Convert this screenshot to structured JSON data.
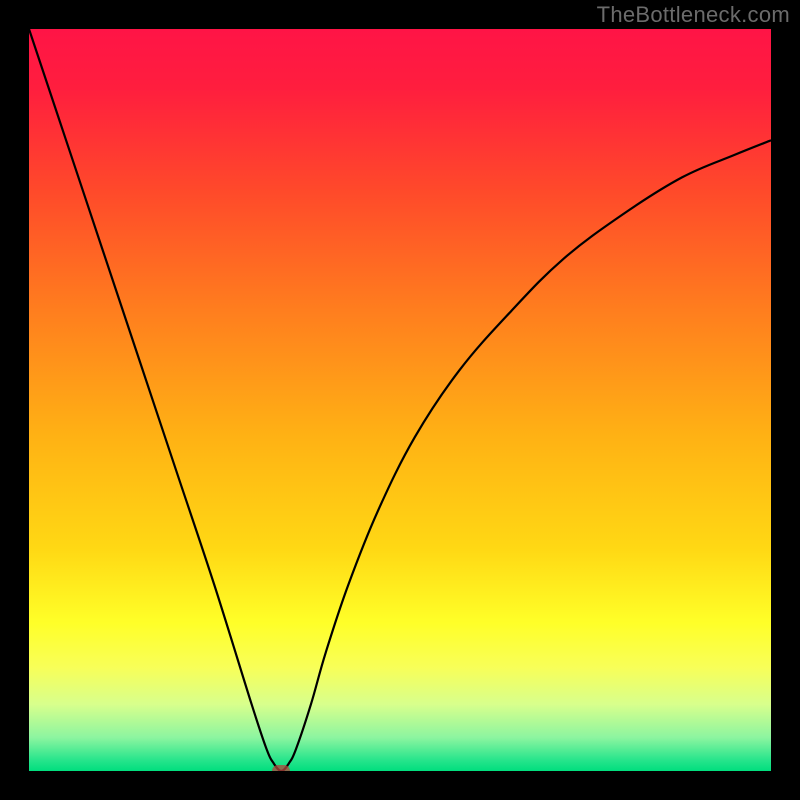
{
  "watermark": "TheBottleneck.com",
  "chart_data": {
    "type": "line",
    "title": "",
    "xlabel": "",
    "ylabel": "",
    "xlim": [
      0,
      100
    ],
    "ylim": [
      0,
      100
    ],
    "gradient_stops": [
      {
        "offset": 0,
        "color": "#ff1446"
      },
      {
        "offset": 0.08,
        "color": "#ff1e3e"
      },
      {
        "offset": 0.22,
        "color": "#ff4a2a"
      },
      {
        "offset": 0.38,
        "color": "#ff7e1e"
      },
      {
        "offset": 0.55,
        "color": "#ffb214"
      },
      {
        "offset": 0.7,
        "color": "#ffd814"
      },
      {
        "offset": 0.8,
        "color": "#ffff28"
      },
      {
        "offset": 0.86,
        "color": "#f8ff58"
      },
      {
        "offset": 0.91,
        "color": "#d8ff8c"
      },
      {
        "offset": 0.955,
        "color": "#8cf5a0"
      },
      {
        "offset": 0.985,
        "color": "#28e58c"
      },
      {
        "offset": 1.0,
        "color": "#00de7e"
      }
    ],
    "series": [
      {
        "name": "bottleneck-curve",
        "x": [
          0,
          5,
          10,
          15,
          20,
          25,
          30,
          32,
          33,
          34,
          35,
          36,
          38,
          40,
          43,
          47,
          52,
          58,
          65,
          72,
          80,
          88,
          95,
          100
        ],
        "values": [
          100,
          85,
          70,
          55,
          40,
          25,
          9,
          3,
          1,
          0,
          1,
          3,
          9,
          16,
          25,
          35,
          45,
          54,
          62,
          69,
          75,
          80,
          83,
          85
        ]
      }
    ],
    "marker": {
      "x": 34,
      "y": 0,
      "color": "rgba(180,70,60,0.75)"
    }
  }
}
